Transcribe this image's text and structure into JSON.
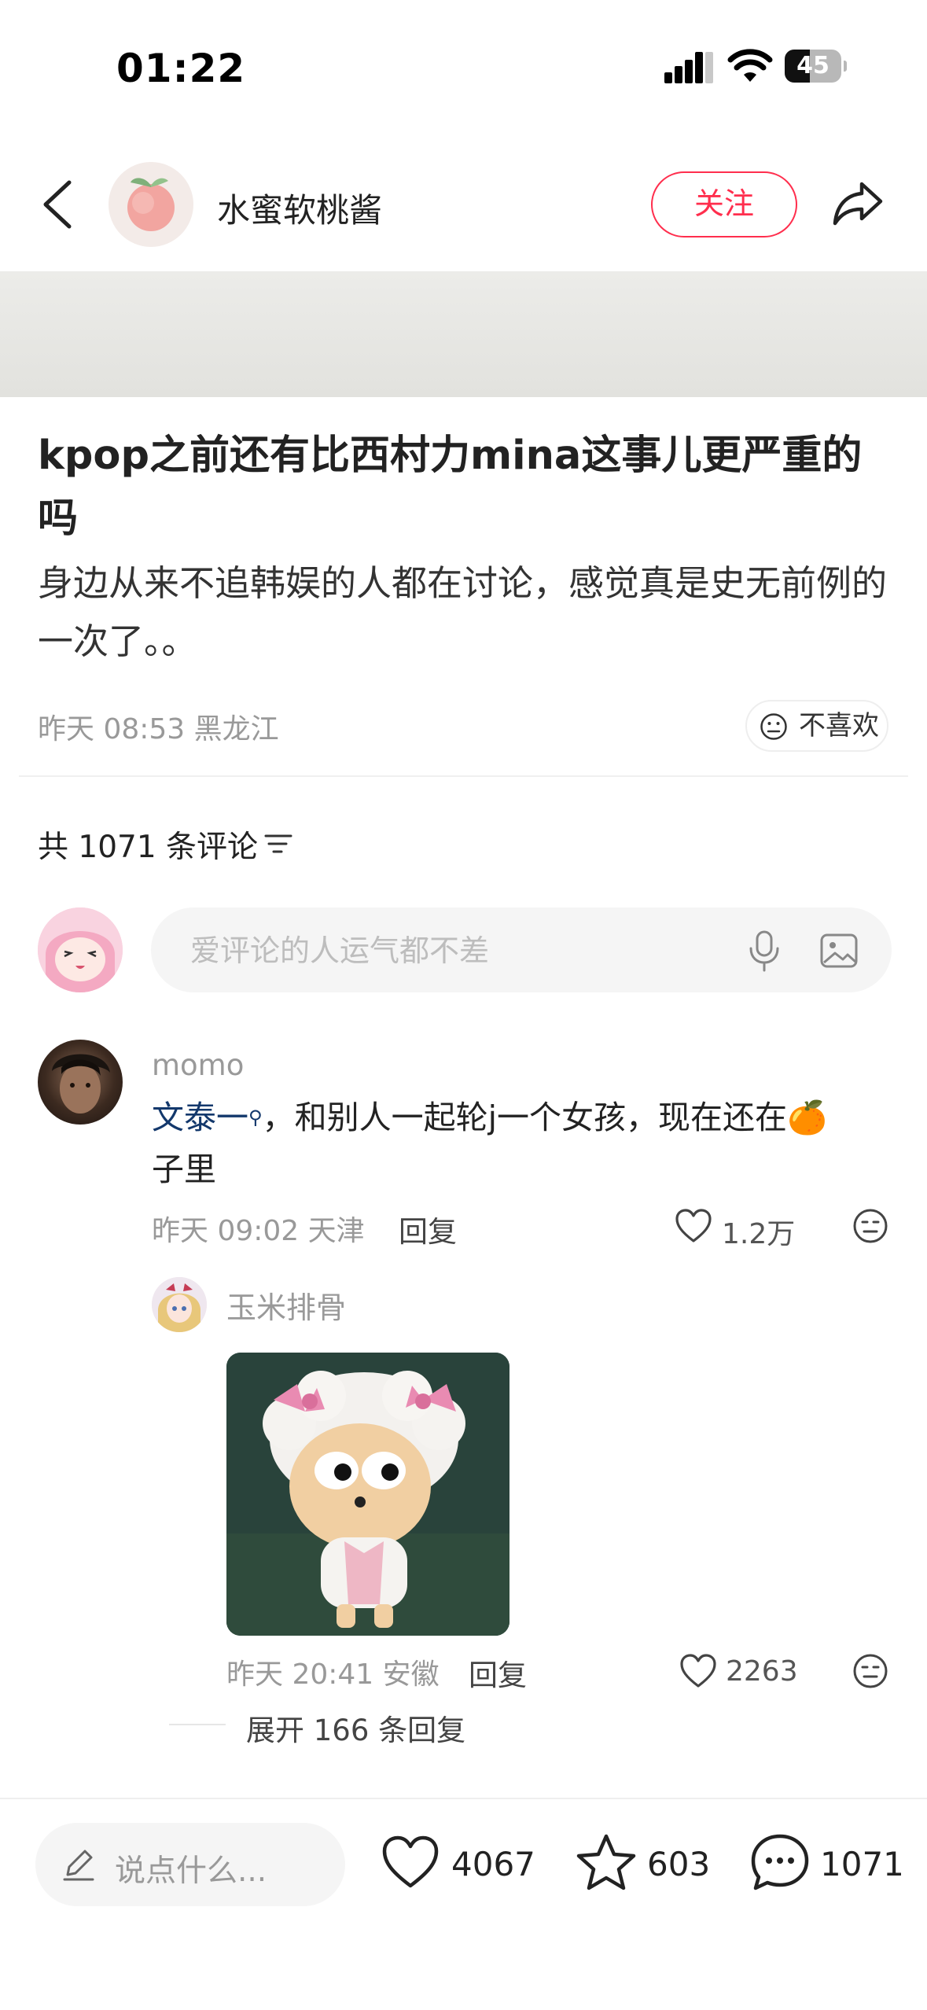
{
  "status_bar": {
    "time": "01:22",
    "battery": "45",
    "battery_level": 0.45
  },
  "header": {
    "author_name": "水蜜软桃酱",
    "follow_label": "关注"
  },
  "post": {
    "title": "kpop之前还有比西村力mina这事儿更严重的吗",
    "body": "身边从来不追韩娱的人都在讨论，感觉真是史无前例的一次了。。",
    "meta": "昨天 08:53 黑龙江",
    "dislike_label": "不喜欢"
  },
  "comments_section": {
    "count_label": "共 1071 条评论",
    "input_placeholder": "爱评论的人运气都不差"
  },
  "comments": [
    {
      "user": "momo",
      "mention": "文泰一",
      "text": "，和别人一起轮j一个女孩，现在还在",
      "emoji": "🍊",
      "text_tail": "子里",
      "meta": "昨天 09:02 天津",
      "reply_label": "回复",
      "likes": "1.2万"
    }
  ],
  "reply": {
    "user": "玉米排骨",
    "meta": "昨天 20:41 安徽",
    "reply_label": "回复",
    "likes": "2263",
    "expand_label": "展开 166 条回复"
  },
  "bottom_bar": {
    "say_placeholder": "说点什么...",
    "likes": "4067",
    "collects": "603",
    "comments": "1071"
  },
  "colors": {
    "accent": "#ff2e4d",
    "mention": "#13386c"
  }
}
